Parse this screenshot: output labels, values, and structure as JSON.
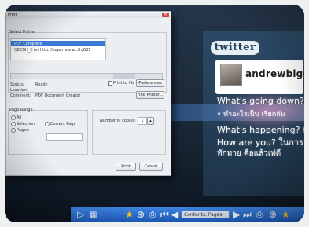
{
  "twitter": {
    "logo": "twitter",
    "username": "andrewbiggs",
    "line1": "What's going down?",
    "line2": "• ทำอะไรเป็น เรียกกัน",
    "line3": "What's happening? หรือ",
    "line4": "How are you? ในการ",
    "line5": "ทักทาย คือแล้วเท่ดี"
  },
  "dialog": {
    "title": "Print",
    "printer_group": "Select Printer",
    "printer_item": "PDF Complete",
    "printer_item2": "\\\\BCDH_E on http://fuge.mde.ac.th/635",
    "status_label": "Status:",
    "status_value": "Ready",
    "location_label": "Location:",
    "comment_label": "Comment:",
    "comment_value": "PDF Document Creator",
    "print_to_file": "Print to file",
    "preferences_button": "Preferences",
    "find_printer_button": "Find Printer...",
    "page_range_group": "Page Range",
    "range_all": "All",
    "range_selection": "Selection",
    "range_current": "Current Page",
    "range_pages": "Pages:",
    "copies_label": "Number of copies:",
    "copies_value": "1",
    "print_button": "Print",
    "cancel_button": "Cancel"
  },
  "toolbar": {
    "search_text": "Contents, Pages"
  },
  "icons": [
    "play-icon",
    "grid-icon",
    "star-icon",
    "search-icon",
    "print-icon",
    "first-page-icon",
    "prev-icon",
    "next-icon",
    "last-page-icon"
  ]
}
